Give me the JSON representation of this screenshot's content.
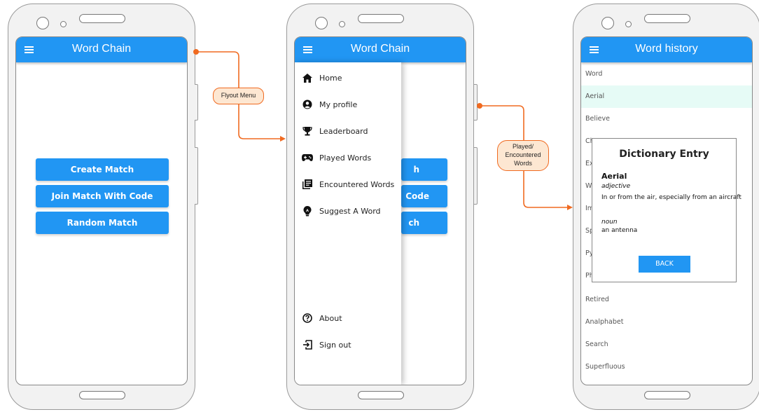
{
  "phone1": {
    "title": "Word Chain",
    "buttons": [
      "Create Match",
      "Join Match With Code",
      "Random Match"
    ]
  },
  "phone2": {
    "title": "Word Chain",
    "menu": [
      {
        "label": "Home",
        "icon": "home-icon"
      },
      {
        "label": "My profile",
        "icon": "profile-icon"
      },
      {
        "label": "Leaderboard",
        "icon": "trophy-icon"
      },
      {
        "label": "Played Words",
        "icon": "gamepad-icon"
      },
      {
        "label": "Encountered  Words",
        "icon": "library-icon"
      },
      {
        "label": "Suggest A Word",
        "icon": "lightbulb-icon"
      }
    ],
    "bottom_menu": [
      {
        "label": "About",
        "icon": "help-icon"
      },
      {
        "label": "Sign out",
        "icon": "sign-out-icon"
      }
    ],
    "background_buttons": [
      "h",
      "Code",
      "ch"
    ]
  },
  "phone3": {
    "title": "Word history",
    "words": [
      "Word",
      "Aerial",
      "Believe",
      "Ch",
      "Ex",
      "Wi",
      "Im",
      "Sp",
      "Py",
      "Ph",
      "Retired",
      "Analphabet",
      "Search",
      "Superfluous"
    ],
    "dialog": {
      "title": "Dictionary Entry",
      "word": "Aerial",
      "pos1": "adjective",
      "def1": "In or from the air, especially from an aircraft",
      "pos2": "noun",
      "def2": "an antenna",
      "back": "BACK"
    }
  },
  "annotations": {
    "flyout": "Flyout Menu",
    "played_line1": "Played/",
    "played_line2": "Encountered",
    "played_line3": "Words"
  },
  "colors": {
    "primary": "#2196f3",
    "connector": "#f06a20",
    "annotation_fill": "#fde7d2",
    "highlight_row": "#e6fbf6"
  }
}
